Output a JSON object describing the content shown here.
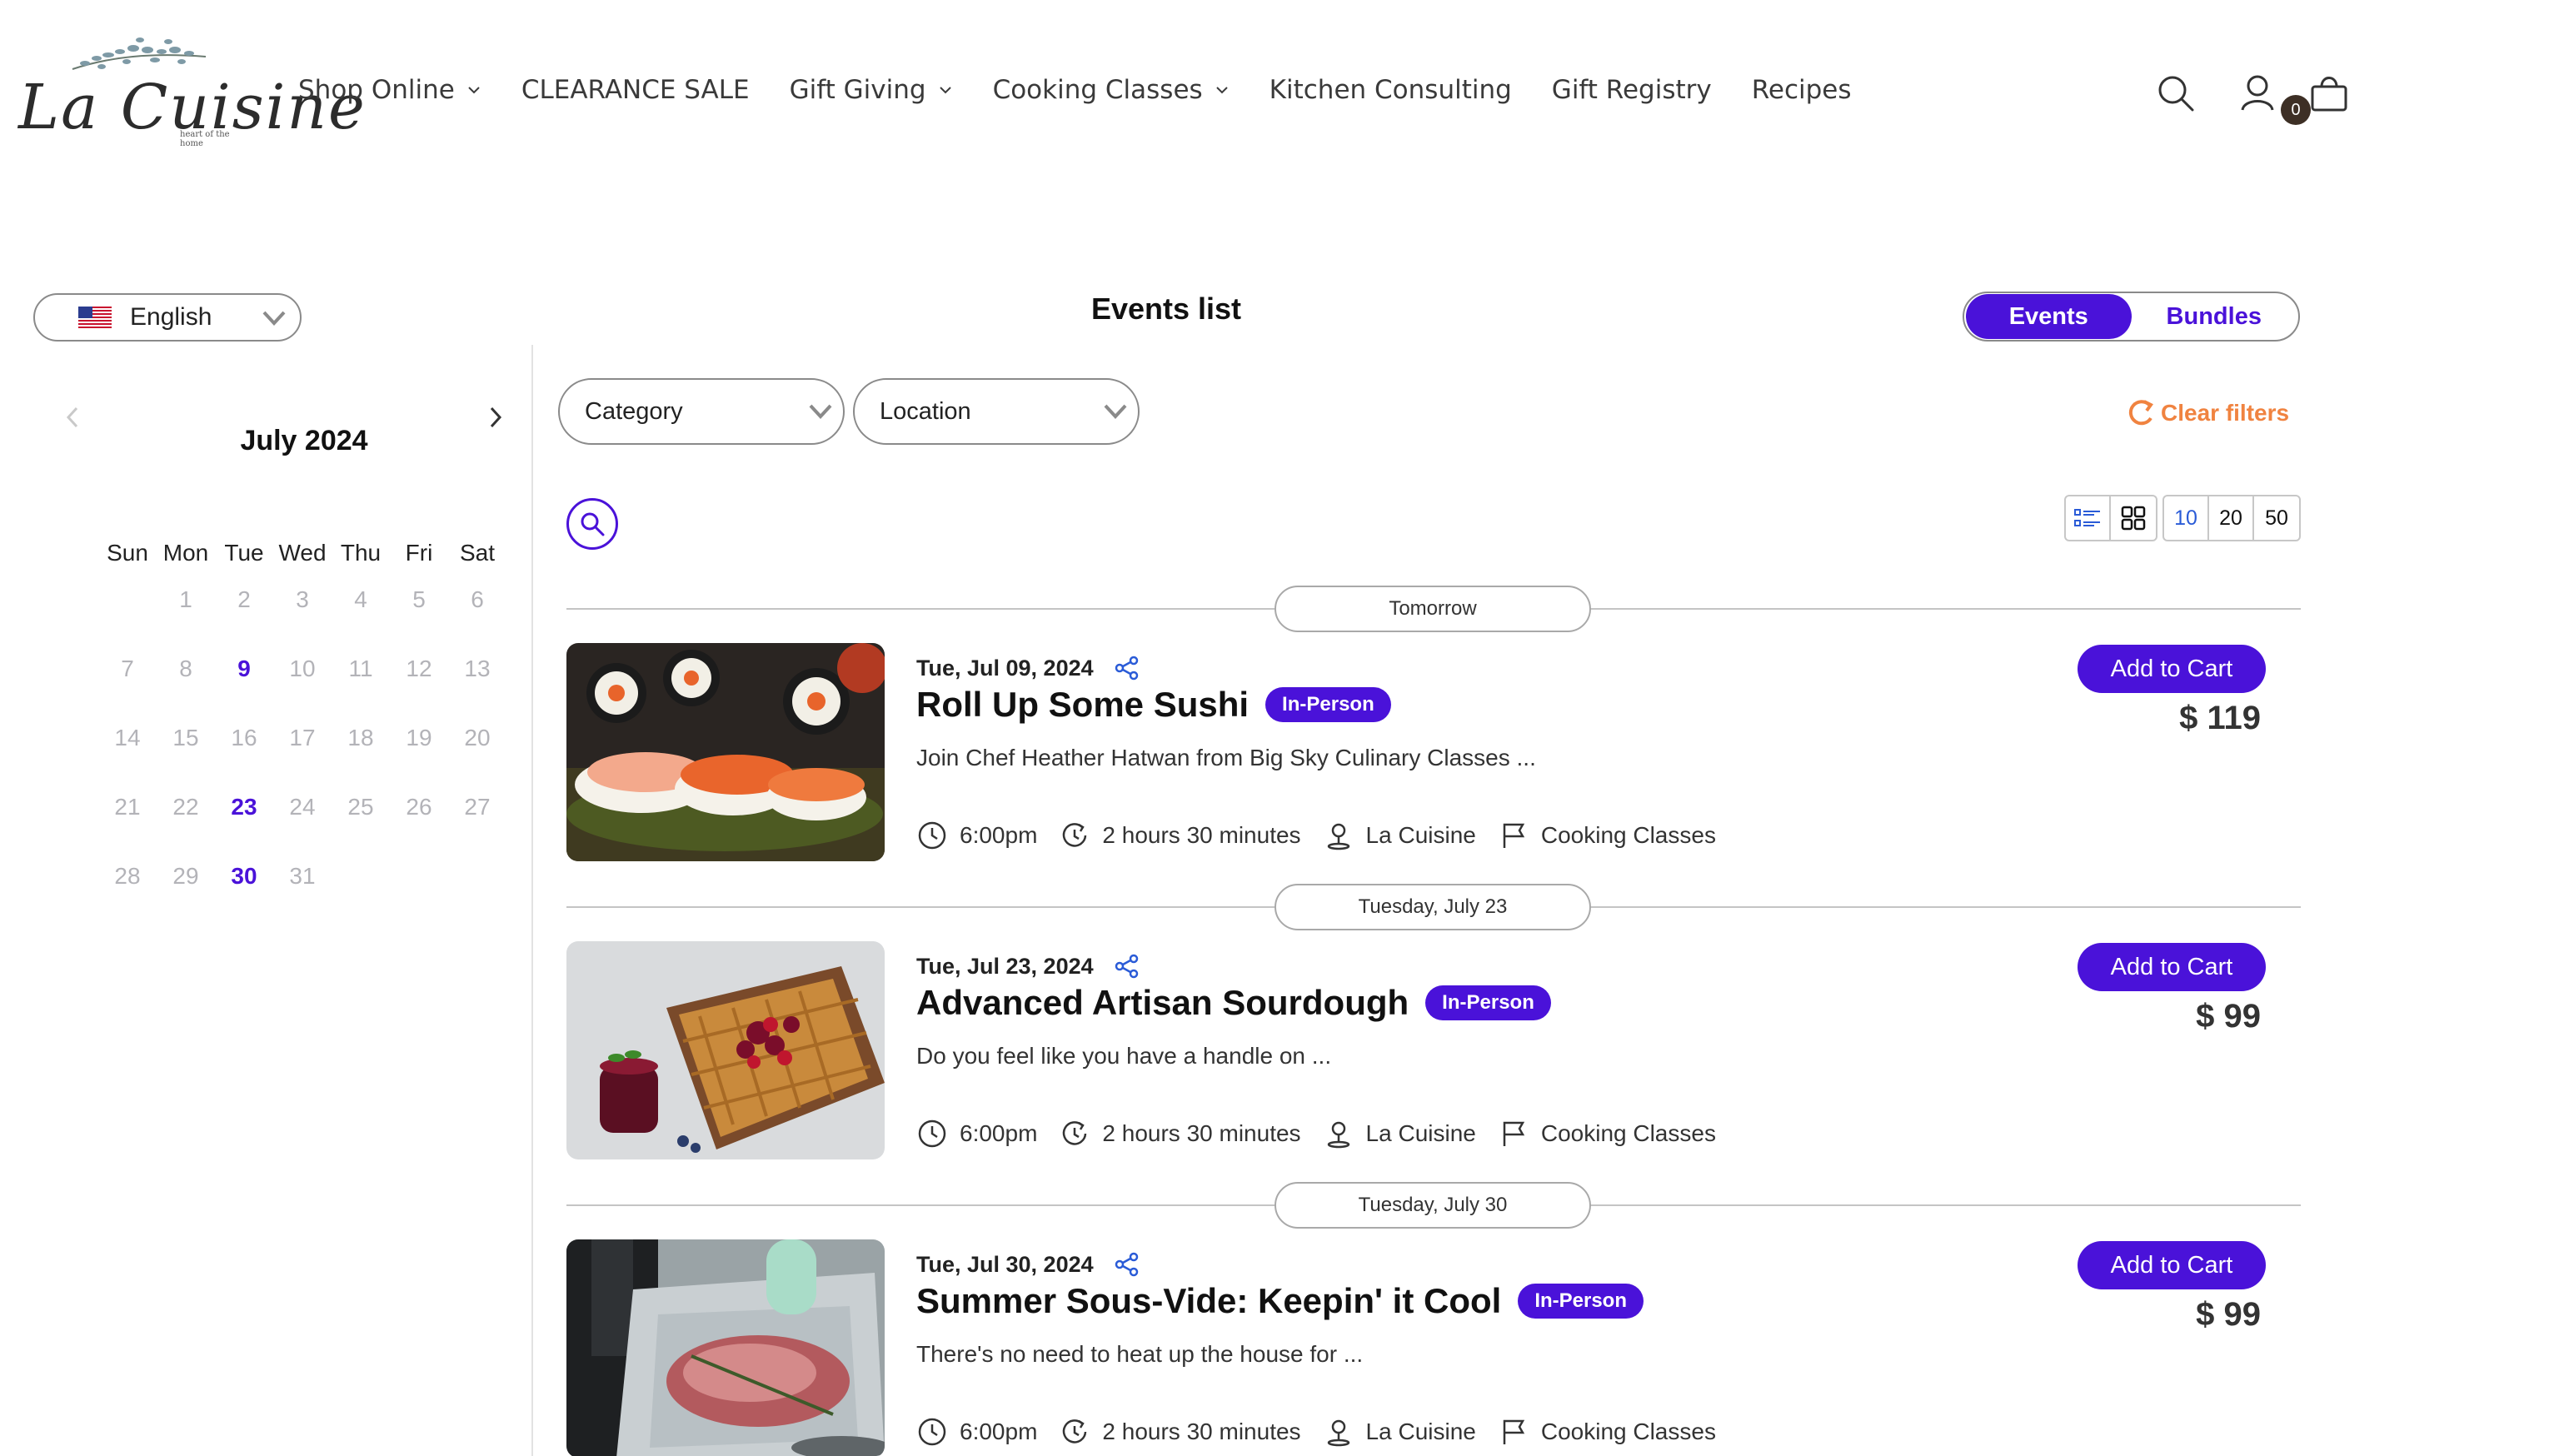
{
  "brand": {
    "name": "La Cuisine",
    "tagline": "heart of the home"
  },
  "nav": {
    "items": [
      {
        "label": "Shop Online",
        "dropdown": true
      },
      {
        "label": "CLEARANCE SALE",
        "dropdown": false
      },
      {
        "label": "Gift Giving",
        "dropdown": true
      },
      {
        "label": "Cooking Classes",
        "dropdown": true
      },
      {
        "label": "Kitchen Consulting",
        "dropdown": false
      },
      {
        "label": "Gift Registry",
        "dropdown": false
      },
      {
        "label": "Recipes",
        "dropdown": false
      }
    ],
    "icons": [
      "search-icon",
      "account-icon",
      "cart-icon"
    ],
    "cart_count": "0"
  },
  "language": {
    "selected": "English",
    "flag": "us-flag-icon"
  },
  "calendar": {
    "title": "July 2024",
    "weekdays": [
      "Sun",
      "Mon",
      "Tue",
      "Wed",
      "Thu",
      "Fri",
      "Sat"
    ],
    "weeks": [
      [
        "",
        "1",
        "2",
        "3",
        "4",
        "5",
        "6"
      ],
      [
        "7",
        "8",
        "9",
        "10",
        "11",
        "12",
        "13"
      ],
      [
        "14",
        "15",
        "16",
        "17",
        "18",
        "19",
        "20"
      ],
      [
        "21",
        "22",
        "23",
        "24",
        "25",
        "26",
        "27"
      ],
      [
        "28",
        "29",
        "30",
        "31",
        "",
        "",
        ""
      ]
    ],
    "event_days": [
      "9",
      "23",
      "30"
    ]
  },
  "main": {
    "title": "Events list",
    "toggle": {
      "events": "Events",
      "bundles": "Bundles"
    },
    "filters": {
      "category": "Category",
      "location": "Location",
      "clear": "Clear filters"
    },
    "page_sizes": [
      "10",
      "20",
      "50"
    ],
    "selected_page_size": "10"
  },
  "events": [
    {
      "group": "Tomorrow",
      "date": "Tue, Jul 09, 2024",
      "title": "Roll Up Some Sushi",
      "badge": "In-Person",
      "desc": "Join Chef Heather Hatwan from Big Sky Culinary Classes ...",
      "time": "6:00pm",
      "duration": "2 hours 30 minutes",
      "location": "La Cuisine",
      "category": "Cooking Classes",
      "cta": "Add to Cart",
      "price": "$ 119"
    },
    {
      "group": "Tuesday, July 23",
      "date": "Tue, Jul 23, 2024",
      "title": "Advanced Artisan Sourdough",
      "badge": "In-Person",
      "desc": "Do you feel like you have a handle on ...",
      "time": "6:00pm",
      "duration": "2 hours 30 minutes",
      "location": "La Cuisine",
      "category": "Cooking Classes",
      "cta": "Add to Cart",
      "price": "$ 99"
    },
    {
      "group": "Tuesday, July 30",
      "date": "Tue, Jul 30, 2024",
      "title": "Summer Sous-Vide: Keepin' it Cool",
      "badge": "In-Person",
      "desc": "There's no need to heat up the house for ...",
      "time": "6:00pm",
      "duration": "2 hours 30 minutes",
      "location": "La Cuisine",
      "category": "Cooking Classes",
      "cta": "Add to Cart",
      "price": "$ 99"
    }
  ],
  "colors": {
    "accent": "#4a12d9",
    "clear": "#f08340",
    "text": "#1a1a1a"
  }
}
